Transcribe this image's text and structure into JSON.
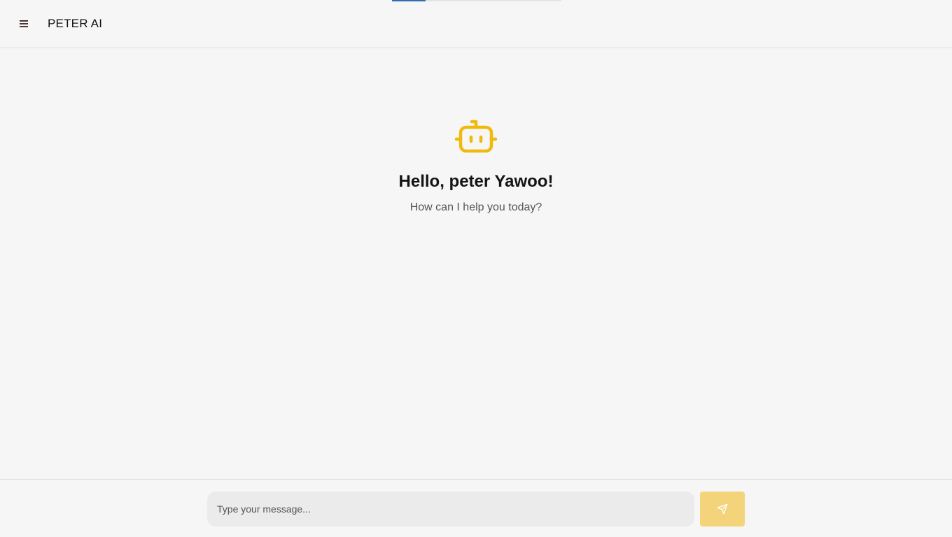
{
  "app": {
    "title": "PETER AI"
  },
  "loading": {
    "progress": 0.2
  },
  "welcome": {
    "icon": "bot-icon",
    "greeting": "Hello, peter Yawoo!",
    "subtitle": "How can I help you today?"
  },
  "composer": {
    "placeholder": "Type your message...",
    "send_icon": "send-icon"
  },
  "colors": {
    "accent": "#f0b90b",
    "send_button": "#f4d47a",
    "progress": "#2f6fb0",
    "background": "#f6f6f6"
  }
}
